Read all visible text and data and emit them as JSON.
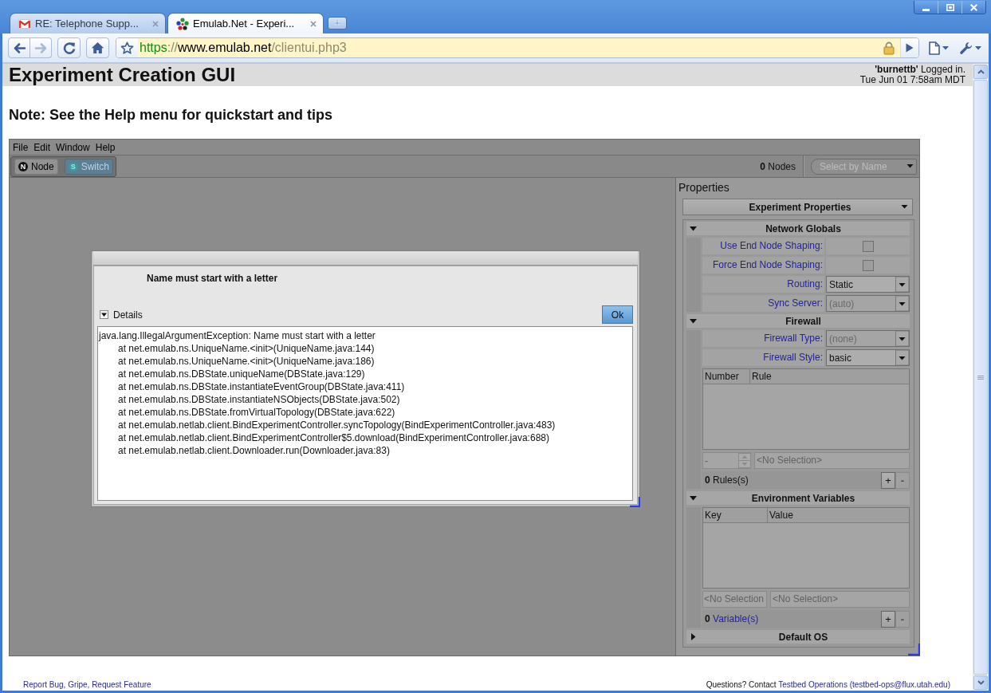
{
  "browser": {
    "tabs": [
      {
        "kind": "mail",
        "title": "RE: Telephone Supp...",
        "selected": false
      },
      {
        "kind": "site",
        "title": "Emulab.Net - Experi...",
        "selected": true
      }
    ],
    "back": {
      "disabled": false
    },
    "forward": {
      "disabled": true
    },
    "address": {
      "scheme": "https",
      "separator": "://",
      "host": "www.emulab.net",
      "path": "/clientui.php3"
    }
  },
  "page": {
    "title": "Experiment Creation GUI",
    "login": "**'burnettb'** Logged in.",
    "datetime": "Tue Jun 01 7:58am MDT",
    "note": "Note: See the Help menu for quickstart and tips"
  },
  "applet": {
    "menu": [
      "File",
      "Edit",
      "Window",
      "Help"
    ],
    "tools": [
      {
        "letter": "N",
        "label": "Node",
        "selected": false
      },
      {
        "letter": "S",
        "label": "Switch",
        "selected": true
      }
    ],
    "node_count": "**0** Nodes",
    "node_select": {
      "placeholder": "Select by Name"
    },
    "properties": {
      "title": "Properties",
      "selector": "Experiment Properties",
      "sections": [
        {
          "title": "Network Globals",
          "expanded": true,
          "rows": [
            {
              "kind": "checkbox",
              "label": "Use End Node Shaping:",
              "checked": false
            },
            {
              "kind": "checkbox",
              "label": "Force End Node Shaping:",
              "checked": false
            },
            {
              "kind": "select",
              "label": "Routing:",
              "value": "Static",
              "disabled": false
            },
            {
              "kind": "select",
              "label": "Sync Server:",
              "value": "(auto)",
              "disabled": true
            }
          ]
        },
        {
          "title": "Firewall",
          "expanded": true,
          "rows": [
            {
              "kind": "select",
              "label": "Firewall Type:",
              "value": "(none)",
              "disabled": true
            },
            {
              "kind": "select",
              "label": "Firewall Style:",
              "value": "basic",
              "disabled": false
            },
            {
              "kind": "table",
              "columns": [
                "Number",
                "Rule"
              ]
            },
            {
              "kind": "editor",
              "fields": [
                {
                  "kind": "spinner",
                  "value": "-",
                  "disabled": true
                },
                {
                  "kind": "text",
                  "value": "<No Selection>",
                  "disabled": true
                }
              ]
            },
            {
              "kind": "counter",
              "count": "0",
              "label": "Rules(s)",
              "link": false,
              "buttons": [
                {
                  "label": "+",
                  "disabled": false
                },
                {
                  "label": "-",
                  "disabled": true
                }
              ]
            }
          ]
        },
        {
          "title": "Environment Variables",
          "expanded": true,
          "rows": [
            {
              "kind": "table",
              "columns": [
                "Key",
                "Value"
              ]
            },
            {
              "kind": "editor",
              "fields": [
                {
                  "kind": "text",
                  "value": "<No Selection",
                  "disabled": true
                },
                {
                  "kind": "text",
                  "value": "<No Selection>",
                  "disabled": true
                }
              ]
            },
            {
              "kind": "counter",
              "count": "0",
              "label": "Variable(s)",
              "link": true,
              "buttons": [
                {
                  "label": "+",
                  "disabled": false
                },
                {
                  "label": "-",
                  "disabled": true
                }
              ]
            }
          ]
        },
        {
          "title": "Default OS",
          "expanded": false
        }
      ]
    },
    "dialog": {
      "message": "Name must start with a letter",
      "details": {
        "label": "Details",
        "expanded": true
      },
      "button": "Ok",
      "exception": "java.lang.IllegalArgumentException: Name must start with a letter",
      "frames": [
        "at net.emulab.ns.UniqueName.<init>(UniqueName.java:144)",
        "at net.emulab.ns.UniqueName.<init>(UniqueName.java:186)",
        "at net.emulab.ns.DBState.uniqueName(DBState.java:129)",
        "at net.emulab.ns.DBState.instantiateEventGroup(DBState.java:411)",
        "at net.emulab.ns.DBState.instantiateNSObjects(DBState.java:502)",
        "at net.emulab.ns.DBState.fromVirtualTopology(DBState.java:622)",
        "at net.emulab.netlab.client.BindExperimentController.syncTopology(BindExperimentController.java:483)",
        "at net.emulab.netlab.client.BindExperimentController$5.download(BindExperimentController.java:688)",
        "at net.emulab.netlab.client.Downloader.run(Downloader.java:83)"
      ]
    }
  },
  "footer": {
    "report_link": "Report Bug, Gripe, Request Feature",
    "contact_text": "Questions? Contact",
    "contact_link": "Testbed Operations (testbed-ops@flux.utah.edu)"
  }
}
